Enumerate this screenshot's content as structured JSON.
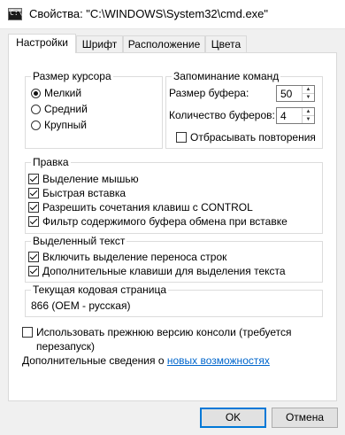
{
  "window": {
    "title": "Свойства: \"C:\\WINDOWS\\System32\\cmd.exe\"",
    "icon_text": "C:\\_"
  },
  "tabs": [
    {
      "label": "Настройки",
      "active": true
    },
    {
      "label": "Шрифт",
      "active": false
    },
    {
      "label": "Расположение",
      "active": false
    },
    {
      "label": "Цвета",
      "active": false
    }
  ],
  "cursor_size": {
    "title": "Размер курсора",
    "options": [
      {
        "label": "Мелкий",
        "selected": true
      },
      {
        "label": "Средний",
        "selected": false
      },
      {
        "label": "Крупный",
        "selected": false
      }
    ]
  },
  "command_history": {
    "title": "Запоминание команд",
    "buffer_size_label": "Размер буфера:",
    "buffer_size_value": "50",
    "buffer_count_label": "Количество буферов:",
    "buffer_count_value": "4",
    "discard_duplicates_label": "Отбрасывать повторения",
    "discard_duplicates_checked": false
  },
  "edit_options": {
    "title": "Правка",
    "items": [
      {
        "label": "Выделение мышью",
        "checked": true
      },
      {
        "label": "Быстрая вставка",
        "checked": true
      },
      {
        "label": "Разрешить сочетания клавиш с CONTROL",
        "checked": true
      },
      {
        "label": "Фильтр содержимого буфера обмена при вставке",
        "checked": true
      }
    ]
  },
  "text_selection": {
    "title": "Выделенный текст",
    "items": [
      {
        "label": "Включить выделение переноса строк",
        "checked": true
      },
      {
        "label": "Дополнительные клавиши для выделения текста",
        "checked": true
      }
    ]
  },
  "codepage": {
    "title": "Текущая кодовая страница",
    "value": "866   (OEM - русская)"
  },
  "legacy_console": {
    "label_line1": "Использовать прежнюю версию консоли (требуется",
    "label_line2": "перезапуск)",
    "checked": false
  },
  "more_info": {
    "text": "Дополнительные сведения о ",
    "link": "новых возможностях"
  },
  "buttons": {
    "ok": "OK",
    "cancel": "Отмена"
  },
  "colors": {
    "accent": "#0078d7",
    "link": "#0066cc"
  }
}
